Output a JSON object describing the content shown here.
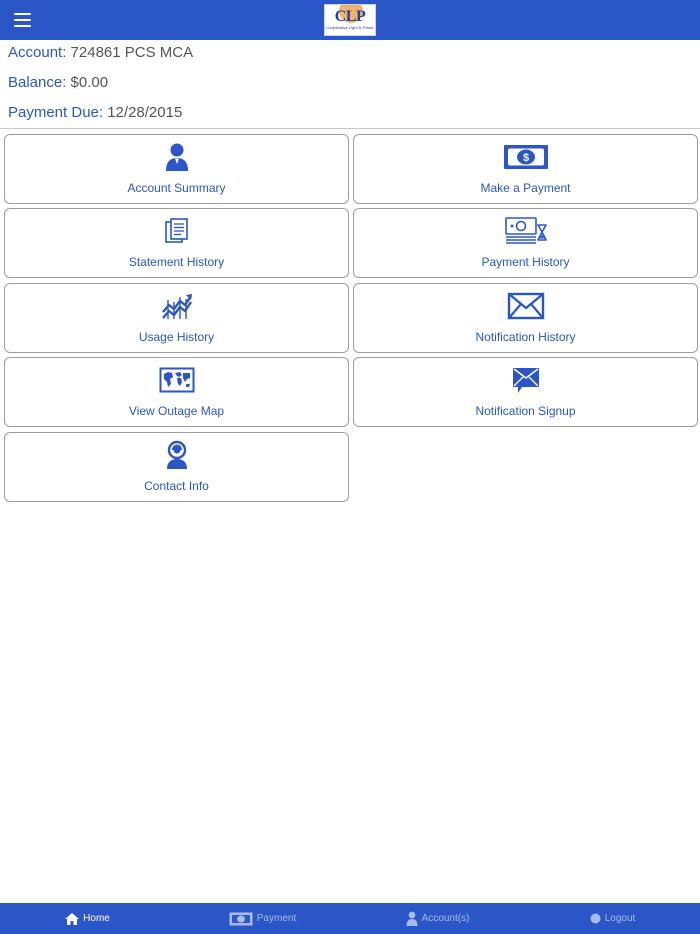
{
  "header": {
    "menu_icon": "hamburger-icon",
    "logo": {
      "mark": "CLP",
      "tagline": "Cooperative Light & Power"
    }
  },
  "account": {
    "account_label": "Account:",
    "account_value": "724861 PCS MCA",
    "balance_label": "Balance:",
    "balance_value": "$0.00",
    "due_label": "Payment Due:",
    "due_value": "12/28/2015"
  },
  "tiles": [
    {
      "label": "Account Summary",
      "icon": "person-icon"
    },
    {
      "label": "Make a Payment",
      "icon": "dollar-bill-icon"
    },
    {
      "label": "Statement History",
      "icon": "documents-icon"
    },
    {
      "label": "Payment History",
      "icon": "money-stack-icon"
    },
    {
      "label": "Usage History",
      "icon": "trend-chart-icon"
    },
    {
      "label": "Notification History",
      "icon": "envelope-icon"
    },
    {
      "label": "View Outage Map",
      "icon": "world-map-icon"
    },
    {
      "label": "Notification Signup",
      "icon": "message-envelope-icon"
    },
    {
      "label": "Contact Info",
      "icon": "contact-person-icon"
    }
  ],
  "bottom_nav": [
    {
      "label": "Home",
      "icon": "home-icon"
    },
    {
      "label": "Payment",
      "icon": "dollar-bill-icon"
    },
    {
      "label": "Account(s)",
      "icon": "person-icon"
    },
    {
      "label": "Logout",
      "icon": "logout-icon"
    }
  ],
  "colors": {
    "brand_blue": "#2b56c8",
    "tile_border": "#9e9e9e",
    "value_gray": "#555555"
  }
}
